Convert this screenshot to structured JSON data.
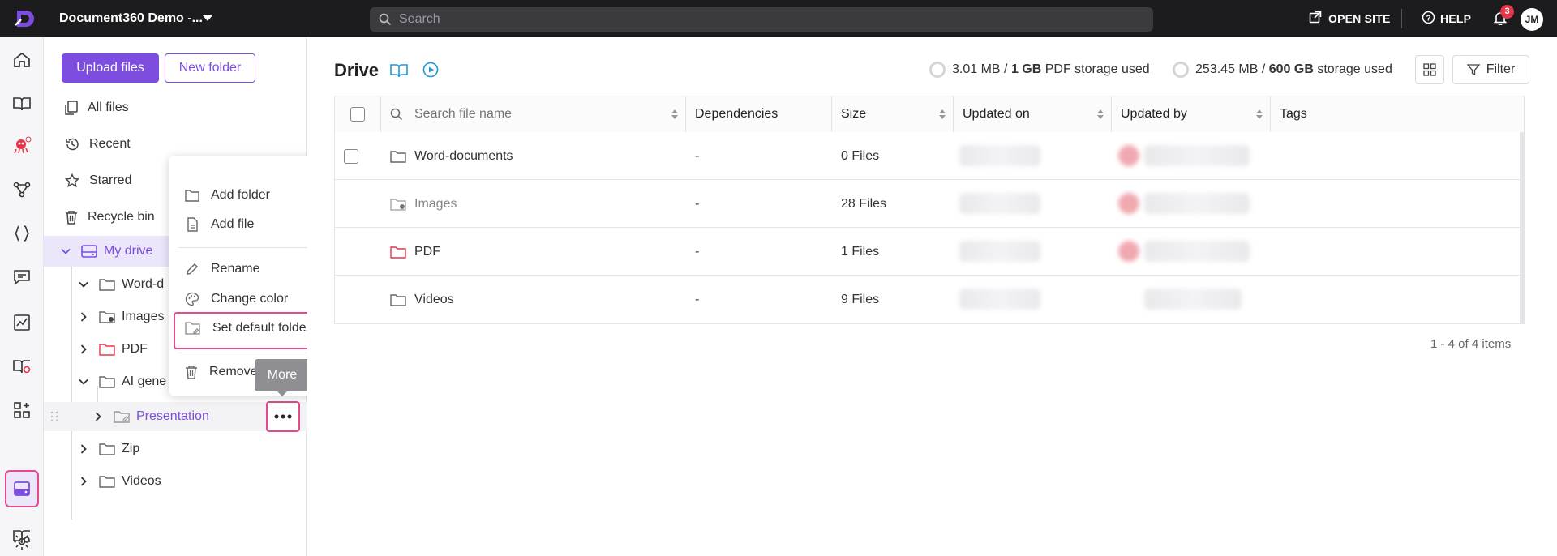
{
  "topbar": {
    "project_name": "Document360 Demo -...",
    "search_placeholder": "Search",
    "open_site": "OPEN SITE",
    "help": "HELP",
    "notification_count": "3",
    "avatar_initials": "JM"
  },
  "sidebar": {
    "upload_button": "Upload files",
    "new_folder_button": "New folder",
    "nav": [
      {
        "label": "All files",
        "icon": "files-icon"
      },
      {
        "label": "Recent",
        "icon": "history-icon"
      },
      {
        "label": "Starred",
        "icon": "star-icon"
      },
      {
        "label": "Recycle bin",
        "icon": "trash-icon"
      }
    ],
    "my_drive": "My drive",
    "tree": [
      {
        "label": "Word-d",
        "expanded": true
      },
      {
        "label": "Images",
        "expanded": false
      },
      {
        "label": "PDF",
        "expanded": false,
        "color": "#e5374b"
      },
      {
        "label": "AI gene",
        "expanded": true
      },
      {
        "label": "Presentation",
        "expanded": false
      },
      {
        "label": "Zip",
        "expanded": false
      },
      {
        "label": "Videos",
        "expanded": false
      }
    ],
    "tooltip": "More"
  },
  "context_menu": {
    "items": [
      {
        "label": "Add folder",
        "icon": "folder-icon"
      },
      {
        "label": "Add file",
        "icon": "file-icon"
      },
      {
        "label": "Rename",
        "icon": "pencil-icon"
      },
      {
        "label": "Change color",
        "icon": "palette-icon"
      },
      {
        "label": "Set default folder",
        "icon": "default-folder-icon"
      },
      {
        "label": "Remove",
        "icon": "trash-icon"
      }
    ]
  },
  "main": {
    "title": "Drive",
    "pdf_storage": {
      "used": "3.01 MB /",
      "total": "1 GB",
      "suffix": "PDF storage used"
    },
    "storage": {
      "used": "253.45 MB /",
      "total": "600 GB",
      "suffix": "storage used"
    },
    "filter_label": "Filter",
    "columns": [
      "Search file name",
      "Dependencies",
      "Size",
      "Updated on",
      "Updated by",
      "Tags"
    ],
    "rows": [
      {
        "name": "Word-documents",
        "dependencies": "-",
        "size": "0 Files"
      },
      {
        "name": "Images",
        "dependencies": "-",
        "size": "28 Files"
      },
      {
        "name": "PDF",
        "dependencies": "-",
        "size": "1 Files"
      },
      {
        "name": "Videos",
        "dependencies": "-",
        "size": "9 Files"
      }
    ],
    "pagination": "1 - 4 of 4 items"
  },
  "colors": {
    "accent": "#7c4ddf",
    "highlight": "#e44a8c",
    "topbar": "#1c1c1e"
  }
}
